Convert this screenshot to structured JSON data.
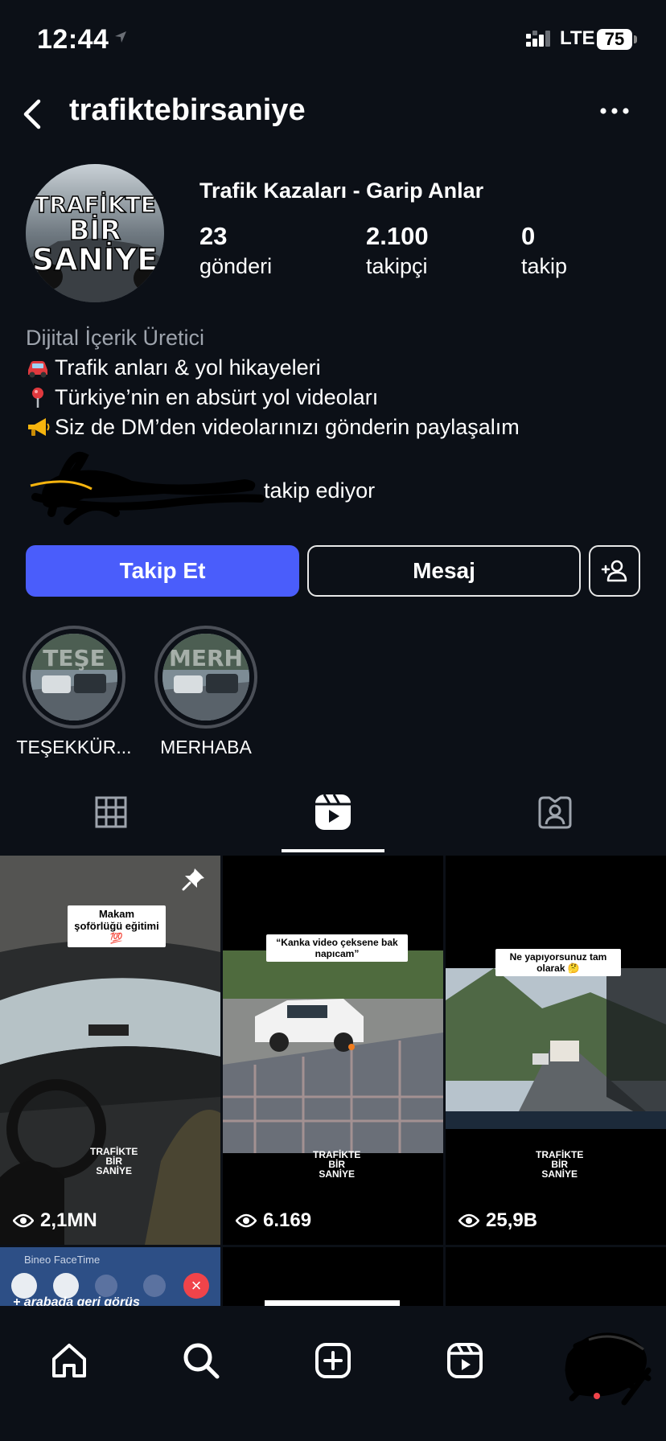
{
  "status_bar": {
    "time": "12:44",
    "network": "LTE",
    "battery": "75"
  },
  "header": {
    "username": "trafiktebirsaniye"
  },
  "profile": {
    "avatar_text": [
      "TRAFİKTE",
      "BİR",
      "SANİYE"
    ],
    "full_name": "Trafik Kazaları - Garip Anlar",
    "stats": [
      {
        "value": "23",
        "label": "gönderi"
      },
      {
        "value": "2.100",
        "label": "takipçi"
      },
      {
        "value": "0",
        "label": "takip"
      }
    ],
    "category": "Dijital İçerik Üretici",
    "bio_lines": [
      {
        "icon": "car-icon",
        "text": "Trafik anları & yol hikayeleri"
      },
      {
        "icon": "pin-icon",
        "text": "Türkiye’nin en absürt yol videoları"
      },
      {
        "icon": "megaphone-icon",
        "text": "Siz de DM’den videolarınızı gönderin paylaşalım"
      }
    ],
    "followed_by": "takip ediyor"
  },
  "actions": {
    "follow": "Takip Et",
    "message": "Mesaj"
  },
  "highlights": [
    {
      "label": "TEŞEKKÜR...",
      "overlay": "TEŞE"
    },
    {
      "label": "MERHABA",
      "overlay": "MERH"
    }
  ],
  "tabs": [
    {
      "icon": "grid-icon",
      "active": false
    },
    {
      "icon": "reels-icon",
      "active": true
    },
    {
      "icon": "tagged-icon",
      "active": false
    }
  ],
  "posts": [
    {
      "caption": "Makam şoförlüğü eğitimi 💯",
      "views": "2,1MN",
      "pinned": true
    },
    {
      "caption": "“Kanka video çeksene bak napıcam”",
      "views": "6.169",
      "pinned": false
    },
    {
      "caption": "Ne yapıyorsunuz tam olarak 🤔",
      "views": "25,9B",
      "pinned": false
    }
  ],
  "watermark": [
    "TRAFİKTE",
    "BİR",
    "SANİYE"
  ],
  "partial_row": {
    "facetime_label": "Bineo FaceTime",
    "caption_fragment": "+ arabada geri görüş"
  },
  "bottom_nav": [
    "home-icon",
    "search-icon",
    "create-icon",
    "reels-icon",
    "profile-icon"
  ],
  "colors": {
    "background": "#0c1017",
    "follow_button": "#4a5dfb",
    "end_call": "#f0444a"
  }
}
